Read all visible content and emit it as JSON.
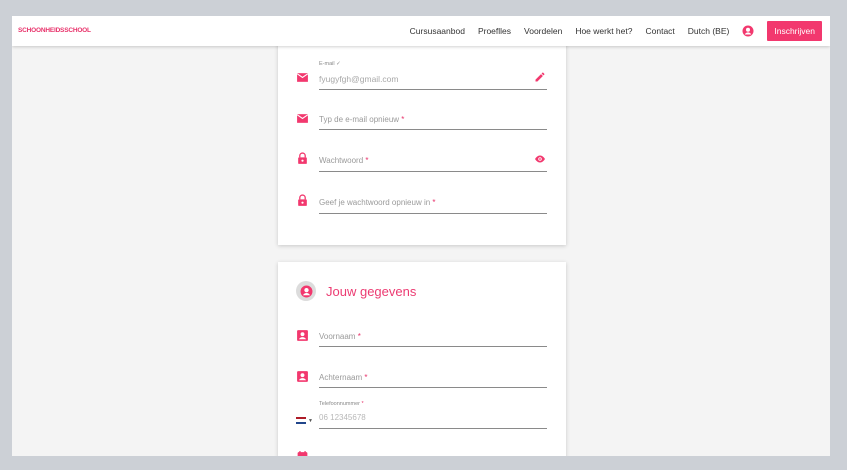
{
  "header": {
    "logo_text": "SCHOONHEIDSSCHOOL",
    "nav": [
      "Cursusaanbod",
      "Proeflles",
      "Voordelen",
      "Hoe werkt het?",
      "Contact",
      "Dutch (BE)"
    ],
    "signup_label": "Inschrijven"
  },
  "account": {
    "email_label": "E-mail ✓",
    "email_value": "fyugyfgh@gmail.com",
    "email_repeat_placeholder": "Typ de e-mail opnieuw",
    "password_placeholder": "Wachtwoord",
    "password_repeat_placeholder": "Geef je wachtwoord opnieuw in",
    "required_mark": "*"
  },
  "personal": {
    "section_title": "Jouw gegevens",
    "first_name_placeholder": "Voornaam",
    "last_name_placeholder": "Achternaam",
    "phone_label": "Telefoonnummer",
    "phone_placeholder": "06 12345678",
    "phone_caret": "▼"
  },
  "colors": {
    "accent": "#f2386e",
    "flag_red": "#ae1c28",
    "flag_white": "#ffffff",
    "flag_blue": "#21468b"
  }
}
